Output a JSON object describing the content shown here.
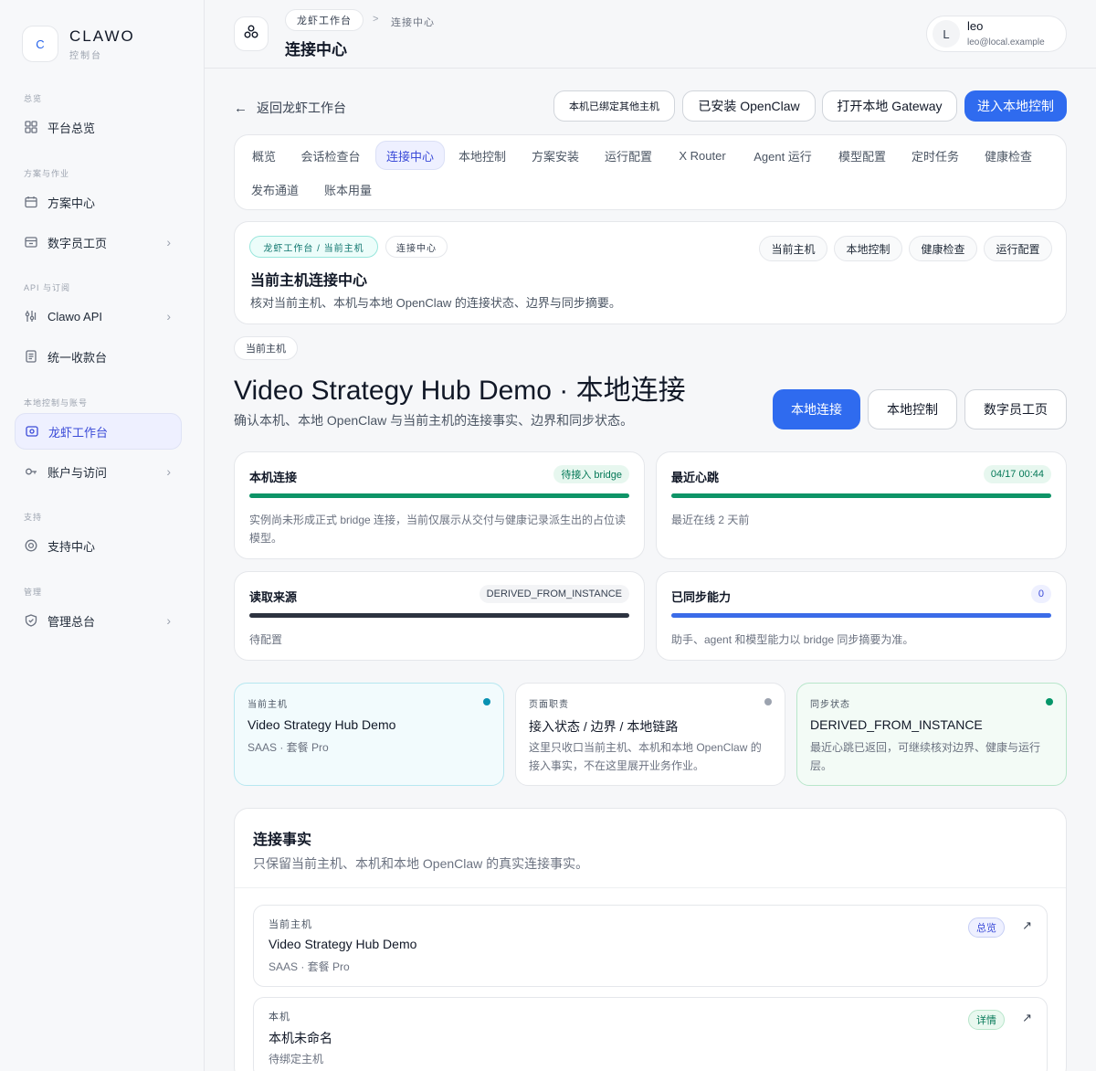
{
  "brand": {
    "logo_letter": "C",
    "name": "CLAWO",
    "sub": "控制台"
  },
  "sidebar": {
    "sections": [
      {
        "label": "总览",
        "items": [
          {
            "label": "平台总览",
            "icon": "grid-icon",
            "chevron": false
          }
        ]
      },
      {
        "label": "方案与作业",
        "items": [
          {
            "label": "方案中心",
            "icon": "calendar-icon",
            "chevron": false
          },
          {
            "label": "数字员工页",
            "icon": "folder-icon",
            "chevron": true
          }
        ]
      },
      {
        "label": "API 与订阅",
        "items": [
          {
            "label": "Clawo API",
            "icon": "api-icon",
            "chevron": true
          },
          {
            "label": "统一收款台",
            "icon": "document-icon",
            "chevron": false
          }
        ]
      },
      {
        "label": "本地控制与账号",
        "items": [
          {
            "label": "龙虾工作台",
            "icon": "workbench-icon",
            "chevron": false,
            "active": true
          },
          {
            "label": "账户与访问",
            "icon": "key-icon",
            "chevron": true
          }
        ]
      },
      {
        "label": "支持",
        "items": [
          {
            "label": "支持中心",
            "icon": "lifebuoy-icon",
            "chevron": false
          }
        ]
      },
      {
        "label": "管理",
        "items": [
          {
            "label": "管理总台",
            "icon": "shield-icon",
            "chevron": true
          }
        ]
      }
    ]
  },
  "header": {
    "breadcrumb_parent": "龙虾工作台",
    "breadcrumb_sep": ">",
    "breadcrumb_current": "连接中心",
    "title": "连接中心",
    "user": {
      "initial": "L",
      "name": "leo",
      "email": "leo@local.example"
    }
  },
  "toolbar": {
    "back": "返回龙虾工作台",
    "bound_other": "本机已绑定其他主机",
    "installed": "已安装 OpenClaw",
    "open_gateway": "打开本地 Gateway",
    "enter_local": "进入本地控制"
  },
  "tabs": [
    "概览",
    "会话检查台",
    "连接中心",
    "本地控制",
    "方案安装",
    "运行配置",
    "X Router",
    "Agent 运行",
    "模型配置",
    "定时任务",
    "健康检查",
    "发布通道",
    "账本用量"
  ],
  "active_tab": "连接中心",
  "hub_card": {
    "chip_path": "龙虾工作台 / 当前主机",
    "chip_page": "连接中心",
    "title": "当前主机连接中心",
    "desc": "核对当前主机、本机与本地 OpenClaw 的连接状态、边界与同步摘要。",
    "actions": [
      "当前主机",
      "本地控制",
      "健康检查",
      "运行配置"
    ]
  },
  "hero": {
    "tag": "当前主机",
    "title": "Video Strategy Hub Demo · 本地连接",
    "subtitle": "确认本机、本地 OpenClaw 与当前主机的连接事实、边界和同步状态。",
    "buttons": [
      "本地连接",
      "本地控制",
      "数字员工页"
    ]
  },
  "stats": [
    {
      "label": "本机连接",
      "badge": "待接入 bridge",
      "text": "实例尚未形成正式 bridge 连接，当前仅展示从交付与健康记录派生出的占位读模型。",
      "bar_color": "#0e9467",
      "badge_bg": "#e7f7ef",
      "badge_color": "#047857"
    },
    {
      "label": "最近心跳",
      "badge": "04/17 00:44",
      "text": "最近在线 2 天前",
      "bar_color": "#0e9467",
      "badge_bg": "#e7f7ef",
      "badge_color": "#047857"
    },
    {
      "label": "读取来源",
      "badge": "DERIVED_FROM_INSTANCE",
      "text": "待配置",
      "bar_color": "#2d3340",
      "badge_bg": "#f3f4f6",
      "badge_color": "#374151"
    },
    {
      "label": "已同步能力",
      "badge": "0",
      "text": "助手、agent 和模型能力以 bridge 同步摘要为准。",
      "bar_color": "#3b6ce8",
      "badge_bg": "#eef0ff",
      "badge_color": "#3b4bd8"
    }
  ],
  "minis": [
    {
      "label": "当前主机",
      "title": "Video Strategy Hub Demo",
      "text": "SAAS · 套餐 Pro",
      "dot": "#0891b2",
      "bg": "#f2fbfd",
      "border": "#b7e7f0"
    },
    {
      "label": "页面职责",
      "title": "接入状态 / 边界 / 本地链路",
      "text": "这里只收口当前主机、本机和本地 OpenClaw 的接入事实，不在这里展开业务作业。",
      "dot": "#9ca3af",
      "bg": "#ffffff",
      "border": "#e5e7eb"
    },
    {
      "label": "同步状态",
      "title": "DERIVED_FROM_INSTANCE",
      "text": "最近心跳已返回，可继续核对边界、健康与运行层。",
      "dot": "#059669",
      "bg": "#f3fbf6",
      "border": "#b8e6cb"
    }
  ],
  "facts": {
    "title": "连接事实",
    "subtitle": "只保留当前主机、本机和本地 OpenClaw 的真实连接事实。",
    "items": [
      {
        "label": "当前主机",
        "title": "Video Strategy Hub Demo",
        "sub": "SAAS · 套餐 Pro",
        "badge": "总览",
        "badge_bg": "#eef0ff",
        "badge_color": "#3b4bd8",
        "badge_border": "#c7cff5"
      },
      {
        "label": "本机",
        "title": "本机未命名",
        "sub": "待绑定主机",
        "badge": "详情",
        "badge_bg": "#e9f8ef",
        "badge_color": "#047857",
        "badge_border": "#b8e6cb"
      }
    ]
  }
}
